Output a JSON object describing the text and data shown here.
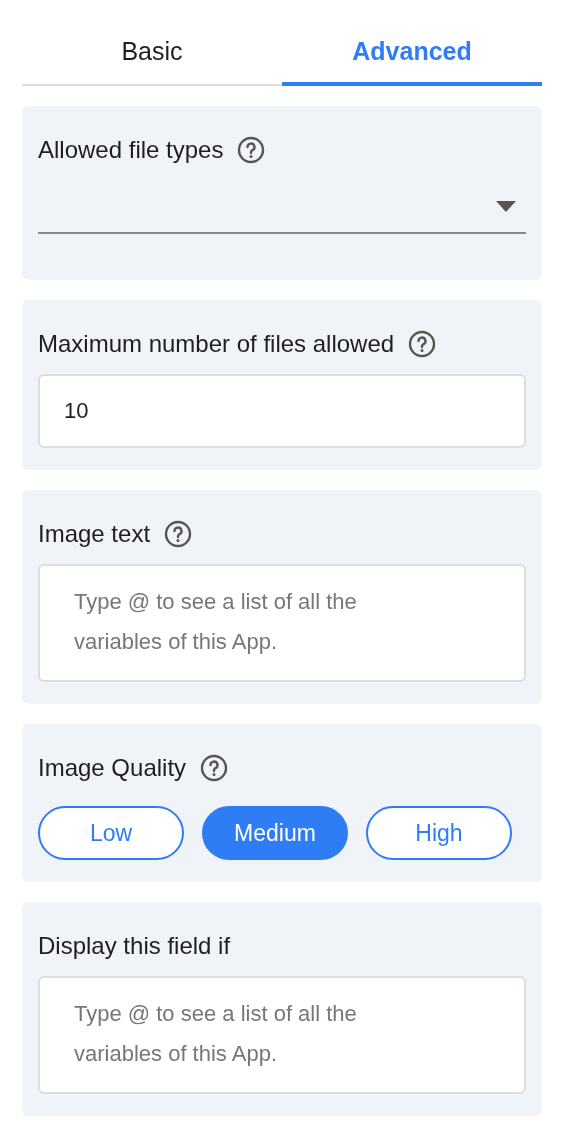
{
  "tabs": [
    {
      "label": "Basic",
      "selected": false
    },
    {
      "label": "Advanced",
      "selected": true
    }
  ],
  "fields": [
    {
      "kind": "select",
      "label": "Allowed file types",
      "help": true
    },
    {
      "kind": "input",
      "label": "Maximum number of files allowed",
      "help": true,
      "value": "10"
    },
    {
      "kind": "textarea",
      "label": "Image text",
      "help": true,
      "placeholder": "Type @ to see a list of all the variables of this App."
    },
    {
      "kind": "segmented",
      "label": "Image Quality",
      "help": true,
      "options": [
        {
          "label": "Low",
          "selected": false
        },
        {
          "label": "Medium",
          "selected": true
        },
        {
          "label": "High",
          "selected": false
        }
      ]
    },
    {
      "kind": "textarea",
      "label": "Display this field if",
      "help": false,
      "placeholder": "Type @ to see a list of all the variables of this App."
    }
  ]
}
